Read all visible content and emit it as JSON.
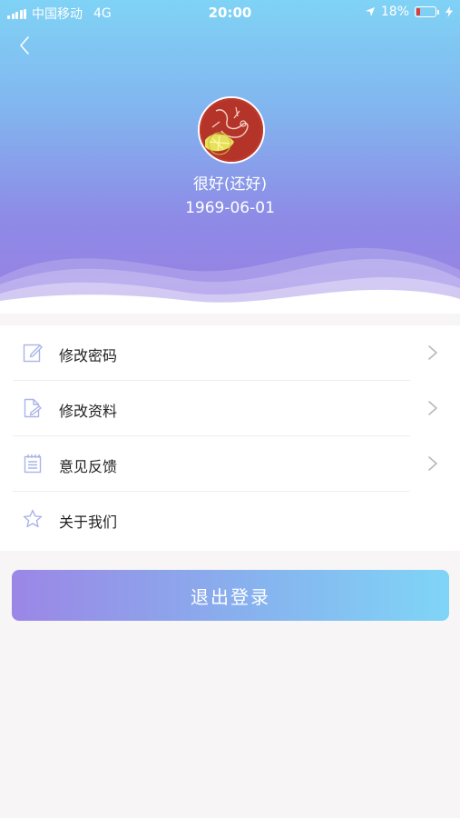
{
  "status_bar": {
    "carrier": "中国移动",
    "network": "4G",
    "time": "20:00",
    "battery_percent": "18%",
    "battery_level": 0.18,
    "battery_color": "#e53935"
  },
  "profile": {
    "nickname": "很好(还好)",
    "birthday": "1969-06-01"
  },
  "menu": {
    "items": [
      {
        "label": "修改密码",
        "icon": "edit-icon",
        "has_arrow": true
      },
      {
        "label": "修改资料",
        "icon": "document-edit-icon",
        "has_arrow": true
      },
      {
        "label": "意见反馈",
        "icon": "notepad-icon",
        "has_arrow": true
      },
      {
        "label": "关于我们",
        "icon": "star-icon",
        "has_arrow": false
      }
    ]
  },
  "logout": {
    "label": "退出登录"
  },
  "colors": {
    "header_top": "#7fd3f5",
    "header_bottom": "#9a80e4",
    "icon_stroke": "#aab4e8",
    "arrow": "#b8b8b8",
    "button_left": "#9b86e6",
    "button_right": "#7fd5f7"
  }
}
